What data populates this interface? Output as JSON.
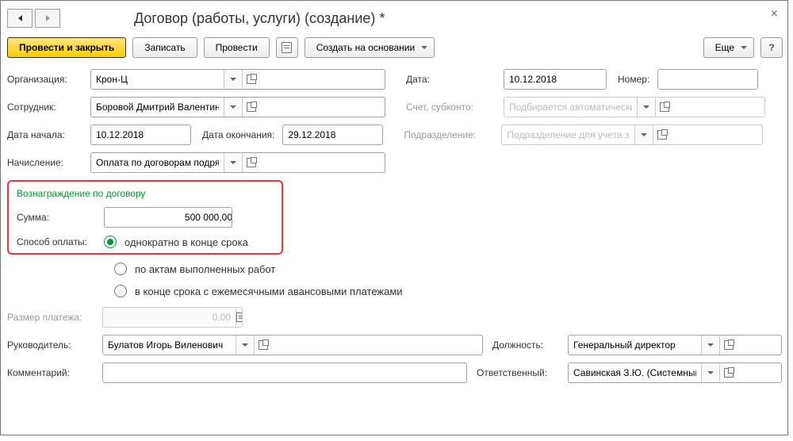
{
  "header": {
    "title": "Договор (работы, услуги) (создание) *"
  },
  "toolbar": {
    "post_close": "Провести и закрыть",
    "save": "Записать",
    "post": "Провести",
    "create_based": "Создать на основании",
    "more": "Еще"
  },
  "form": {
    "org_label": "Организация:",
    "org_value": "Крон-Ц",
    "date_label": "Дата:",
    "date_value": "10.12.2018",
    "number_label": "Номер:",
    "employee_label": "Сотрудник:",
    "employee_value": "Боровой Дмитрий Валентинович",
    "account_label": "Счет, субконто:",
    "account_placeholder": "Подбирается автоматически",
    "start_label": "Дата начала:",
    "start_value": "10.12.2018",
    "end_label": "Дата окончания:",
    "end_value": "29.12.2018",
    "dept_label": "Подразделение:",
    "dept_placeholder": "Подразделение для учета затрат",
    "accrual_label": "Начисление:",
    "accrual_value": "Оплата по договорам подряда",
    "payment_size_label": "Размер платежа:",
    "payment_size_value": "0,00",
    "manager_label": "Руководитель:",
    "manager_value": "Булатов Игорь Виленович",
    "position_label": "Должность:",
    "position_value": "Генеральный директор",
    "comment_label": "Комментарий:",
    "responsible_label": "Ответственный:",
    "responsible_value": "Савинская З.Ю. (Системный прог"
  },
  "reward": {
    "title": "Вознаграждение по договору",
    "amount_label": "Сумма:",
    "amount_value": "500 000,00",
    "method_label": "Способ оплаты:",
    "options": [
      "однократно в конце срока",
      "по актам выполненных работ",
      "в конце срока с ежемесячными авансовыми платежами"
    ]
  }
}
